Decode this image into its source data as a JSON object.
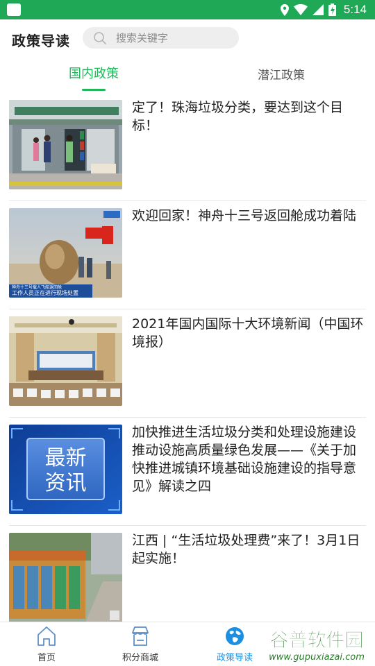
{
  "status_bar": {
    "time": "5:14",
    "icons": [
      "location-icon",
      "wifi-icon",
      "signal-icon",
      "battery-charging-icon"
    ],
    "color": "#1fa855"
  },
  "header": {
    "title": "政策导读",
    "search_placeholder": "搜索关键字"
  },
  "tabs": [
    {
      "label": "国内政策",
      "active": true
    },
    {
      "label": "潜江政策",
      "active": false
    }
  ],
  "news": [
    {
      "title": "定了！珠海垃圾分类，要达到这个目标！",
      "thumb": "recycling-station-photo"
    },
    {
      "title": "欢迎回家！神舟十三号返回舱成功着陆",
      "thumb": "return-capsule-photo",
      "thumb_caption": "工作人员正在进行现场处置"
    },
    {
      "title": "2021年国内国际十大环境新闻（中国环境报）",
      "thumb": "conference-room-photo"
    },
    {
      "title": "加快推进生活垃圾分类和处理设施建设 推动设施高质量绿色发展——《关于加快推进城镇环境基础设施建设的指导意见》解读之四",
      "thumb": "latest-news-banner",
      "thumb_text_line1": "最新",
      "thumb_text_line2": "资讯"
    },
    {
      "title": "江西 | “生活垃圾处理费”来了！3月1日起实施！",
      "thumb": "sorting-bins-photo"
    }
  ],
  "bottom_nav": [
    {
      "label": "首页",
      "icon": "home-icon",
      "active": false
    },
    {
      "label": "积分商城",
      "icon": "store-icon",
      "active": false
    },
    {
      "label": "政策导读",
      "icon": "globe-icon",
      "active": true
    }
  ],
  "watermark": {
    "line1": "谷普软件园",
    "line2": "www.gupuxiazai.com"
  },
  "colors": {
    "accent_green": "#1fb659",
    "nav_active_blue": "#1d8fe0"
  }
}
